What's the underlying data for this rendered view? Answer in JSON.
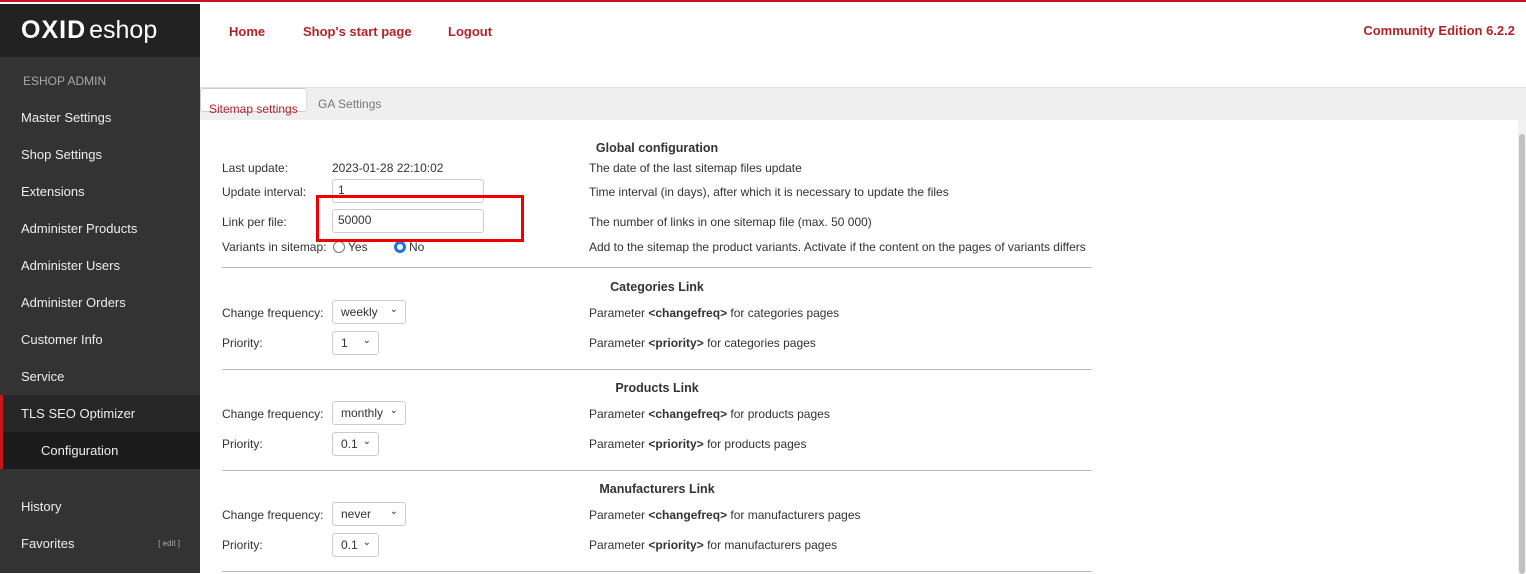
{
  "logo": {
    "bold": "OXID",
    "light": "eshop"
  },
  "sidebar": {
    "section": "ESHOP ADMIN",
    "items": [
      {
        "label": "Master Settings"
      },
      {
        "label": "Shop Settings"
      },
      {
        "label": "Extensions"
      },
      {
        "label": "Administer Products"
      },
      {
        "label": "Administer Users"
      },
      {
        "label": "Administer Orders"
      },
      {
        "label": "Customer Info"
      },
      {
        "label": "Service"
      },
      {
        "label": "TLS SEO Optimizer"
      },
      {
        "label": "Configuration"
      },
      {
        "label": "History"
      },
      {
        "label": "Favorites"
      }
    ],
    "edit": "[ edit ]"
  },
  "header": {
    "links": [
      "Home",
      "Shop's start page",
      "Logout"
    ],
    "edition": "Community Edition 6.2.2"
  },
  "tabs": [
    "Sitemap settings",
    "GA Settings"
  ],
  "global": {
    "title": "Global configuration",
    "last_update_label": "Last update:",
    "last_update": "2023-01-28 22:10:02",
    "last_update_desc": "The date of the last sitemap files update",
    "interval_label": "Update interval:",
    "interval": "1",
    "interval_desc": "Time interval (in days), after which it is necessary to update the files",
    "links_label": "Link per file:",
    "links": "50000",
    "links_desc": "The number of links in one sitemap file (max. 50 000)",
    "variants_label": "Variants in sitemap:",
    "yes": "Yes",
    "no": "No",
    "variants_desc": "Add to the sitemap the product variants. Activate if the content on the pages of variants differs"
  },
  "sections": [
    {
      "title": "Categories Link",
      "freq_label": "Change frequency:",
      "freq": "weekly",
      "prio_label": "Priority:",
      "prio": "1",
      "param": "Parameter",
      "freq_tag": "<changefreq>",
      "prio_tag": "<priority>",
      "freq_desc": "for categories pages",
      "prio_desc": "for categories pages"
    },
    {
      "title": "Products Link",
      "freq_label": "Change frequency:",
      "freq": "monthly",
      "prio_label": "Priority:",
      "prio": "0.1",
      "param": "Parameter",
      "freq_tag": "<changefreq>",
      "prio_tag": "<priority>",
      "freq_desc": "for products pages",
      "prio_desc": "for products pages"
    },
    {
      "title": "Manufacturers Link",
      "freq_label": "Change frequency:",
      "freq": "never",
      "prio_label": "Priority:",
      "prio": "0.1",
      "param": "Parameter",
      "freq_tag": "<changefreq>",
      "prio_tag": "<priority>",
      "freq_desc": "for manufacturers pages",
      "prio_desc": "for manufacturers pages"
    }
  ]
}
